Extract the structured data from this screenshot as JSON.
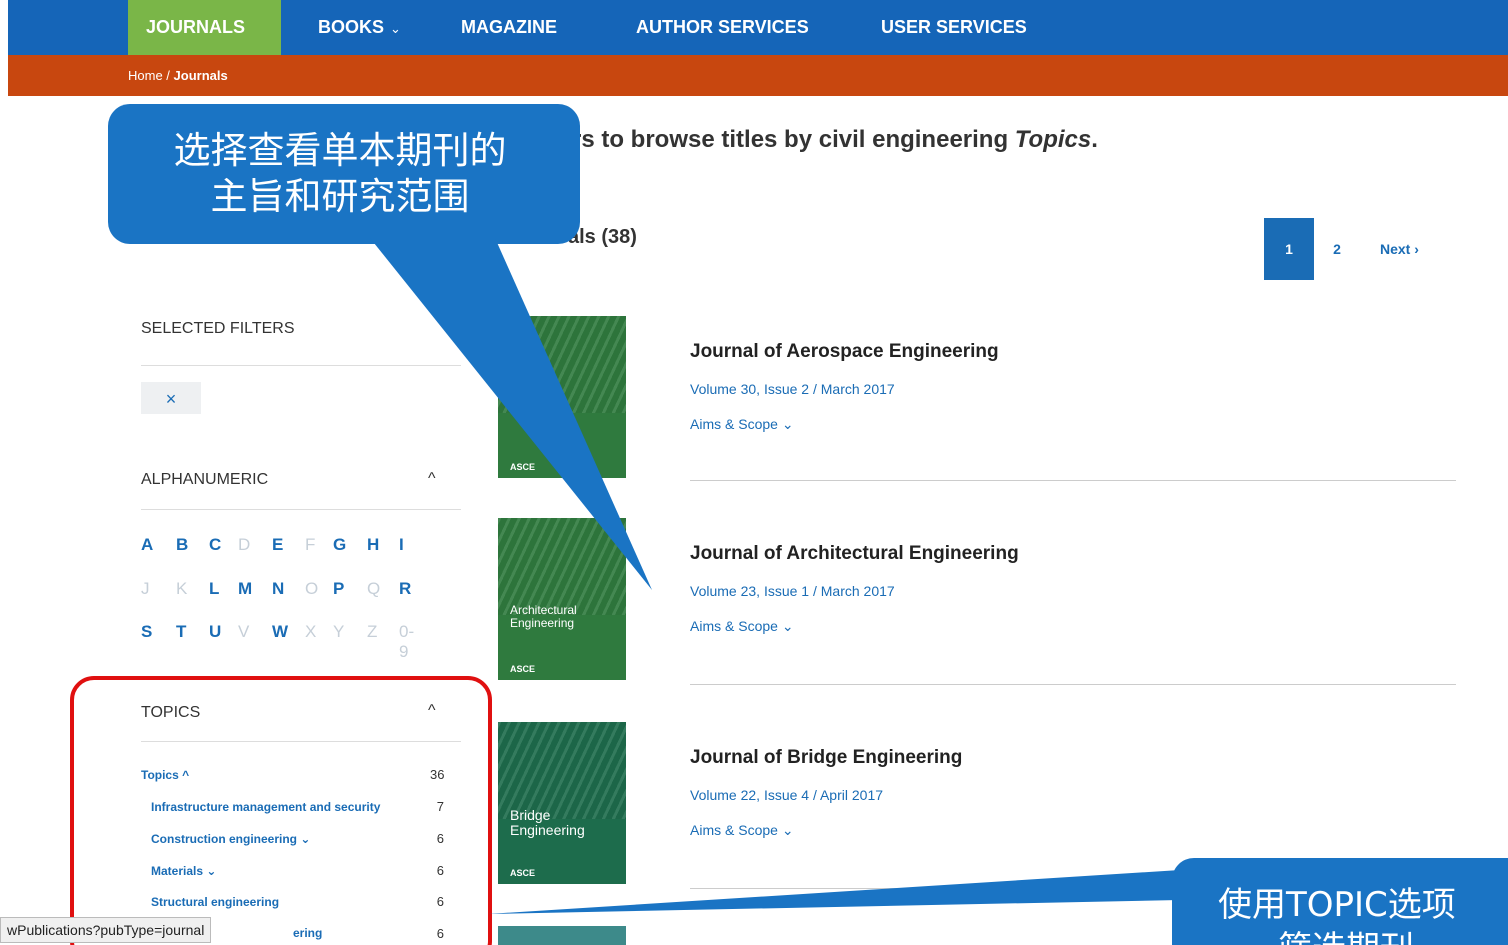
{
  "nav": {
    "items": [
      {
        "label": "JOURNALS"
      },
      {
        "label": "BOOKS"
      },
      {
        "label": "MAGAZINE"
      },
      {
        "label": "AUTHOR SERVICES"
      },
      {
        "label": "USER SERVICES"
      }
    ],
    "books_chevron": "⌄"
  },
  "breadcrumb": {
    "home": "Home",
    "sep": " / ",
    "current": "Journals"
  },
  "intro": {
    "text": "rs to browse titles by civil engineering ",
    "emph": "Topics",
    "end": "."
  },
  "results": {
    "count_text": "als (38)"
  },
  "pagination": {
    "page1": "1",
    "page2": "2",
    "next": "Next ›"
  },
  "sidebar": {
    "selected_filters_label": "SELECTED FILTERS",
    "filter_chip": "×",
    "alphanumeric_label": "ALPHANUMERIC",
    "caret": "^",
    "alphabet": [
      [
        {
          "c": "A",
          "on": true
        },
        {
          "c": "B",
          "on": true
        },
        {
          "c": "C",
          "on": true
        },
        {
          "c": "D",
          "on": false
        },
        {
          "c": "E",
          "on": true
        },
        {
          "c": "F",
          "on": false
        },
        {
          "c": "G",
          "on": true
        },
        {
          "c": "H",
          "on": true
        },
        {
          "c": "I",
          "on": true
        }
      ],
      [
        {
          "c": "J",
          "on": false
        },
        {
          "c": "K",
          "on": false
        },
        {
          "c": "L",
          "on": true
        },
        {
          "c": "M",
          "on": true
        },
        {
          "c": "N",
          "on": true
        },
        {
          "c": "O",
          "on": false
        },
        {
          "c": "P",
          "on": true
        },
        {
          "c": "Q",
          "on": false
        },
        {
          "c": "R",
          "on": true
        }
      ],
      [
        {
          "c": "S",
          "on": true
        },
        {
          "c": "T",
          "on": true
        },
        {
          "c": "U",
          "on": true
        },
        {
          "c": "V",
          "on": false
        },
        {
          "c": "W",
          "on": true
        },
        {
          "c": "X",
          "on": false
        },
        {
          "c": "Y",
          "on": false
        },
        {
          "c": "Z",
          "on": false
        },
        {
          "c": "0-9",
          "on": false
        }
      ]
    ],
    "topics_label": "TOPICS",
    "topics": [
      {
        "label": "Topics ^",
        "count": "36"
      },
      {
        "label": "Infrastructure management and security",
        "count": "7"
      },
      {
        "label": "Construction engineering ⌄",
        "count": "6"
      },
      {
        "label": "Materials ⌄",
        "count": "6"
      },
      {
        "label": "Structural engineering",
        "count": "6"
      },
      {
        "label": "ering",
        "count": "6"
      }
    ]
  },
  "journals": [
    {
      "title": "Journal of Aerospace Engineering",
      "volume": "Volume 30, Issue 2 / March 2017",
      "aims": "Aims & Scope ⌄",
      "cover_title": "",
      "brand": "ASCE"
    },
    {
      "title": "Journal of Architectural Engineering",
      "volume": "Volume 23, Issue 1 / March 2017",
      "aims": "Aims & Scope ⌄",
      "cover_title": "Architectural\nEngineering",
      "brand": "ASCE"
    },
    {
      "title": "Journal of Bridge Engineering",
      "volume": "Volume 22, Issue 4 / April 2017",
      "aims": "Aims & Scope ⌄",
      "cover_title": "Bridge\nEngineering",
      "brand": "ASCE"
    }
  ],
  "callouts": {
    "c1_line1": "选择查看单本期刊的",
    "c1_line2": "主旨和研究范围",
    "c2_line1": "使用TOPIC选项",
    "c2_line2": "筛选期刊"
  },
  "status_url": "wPublications?pubType=journal",
  "colors": {
    "nav": "#1565b8",
    "nav_active": "#7ab648",
    "crumb": "#c8470f",
    "link": "#1a6cb5",
    "callout": "#1a74c4",
    "highlight": "#e01010"
  }
}
